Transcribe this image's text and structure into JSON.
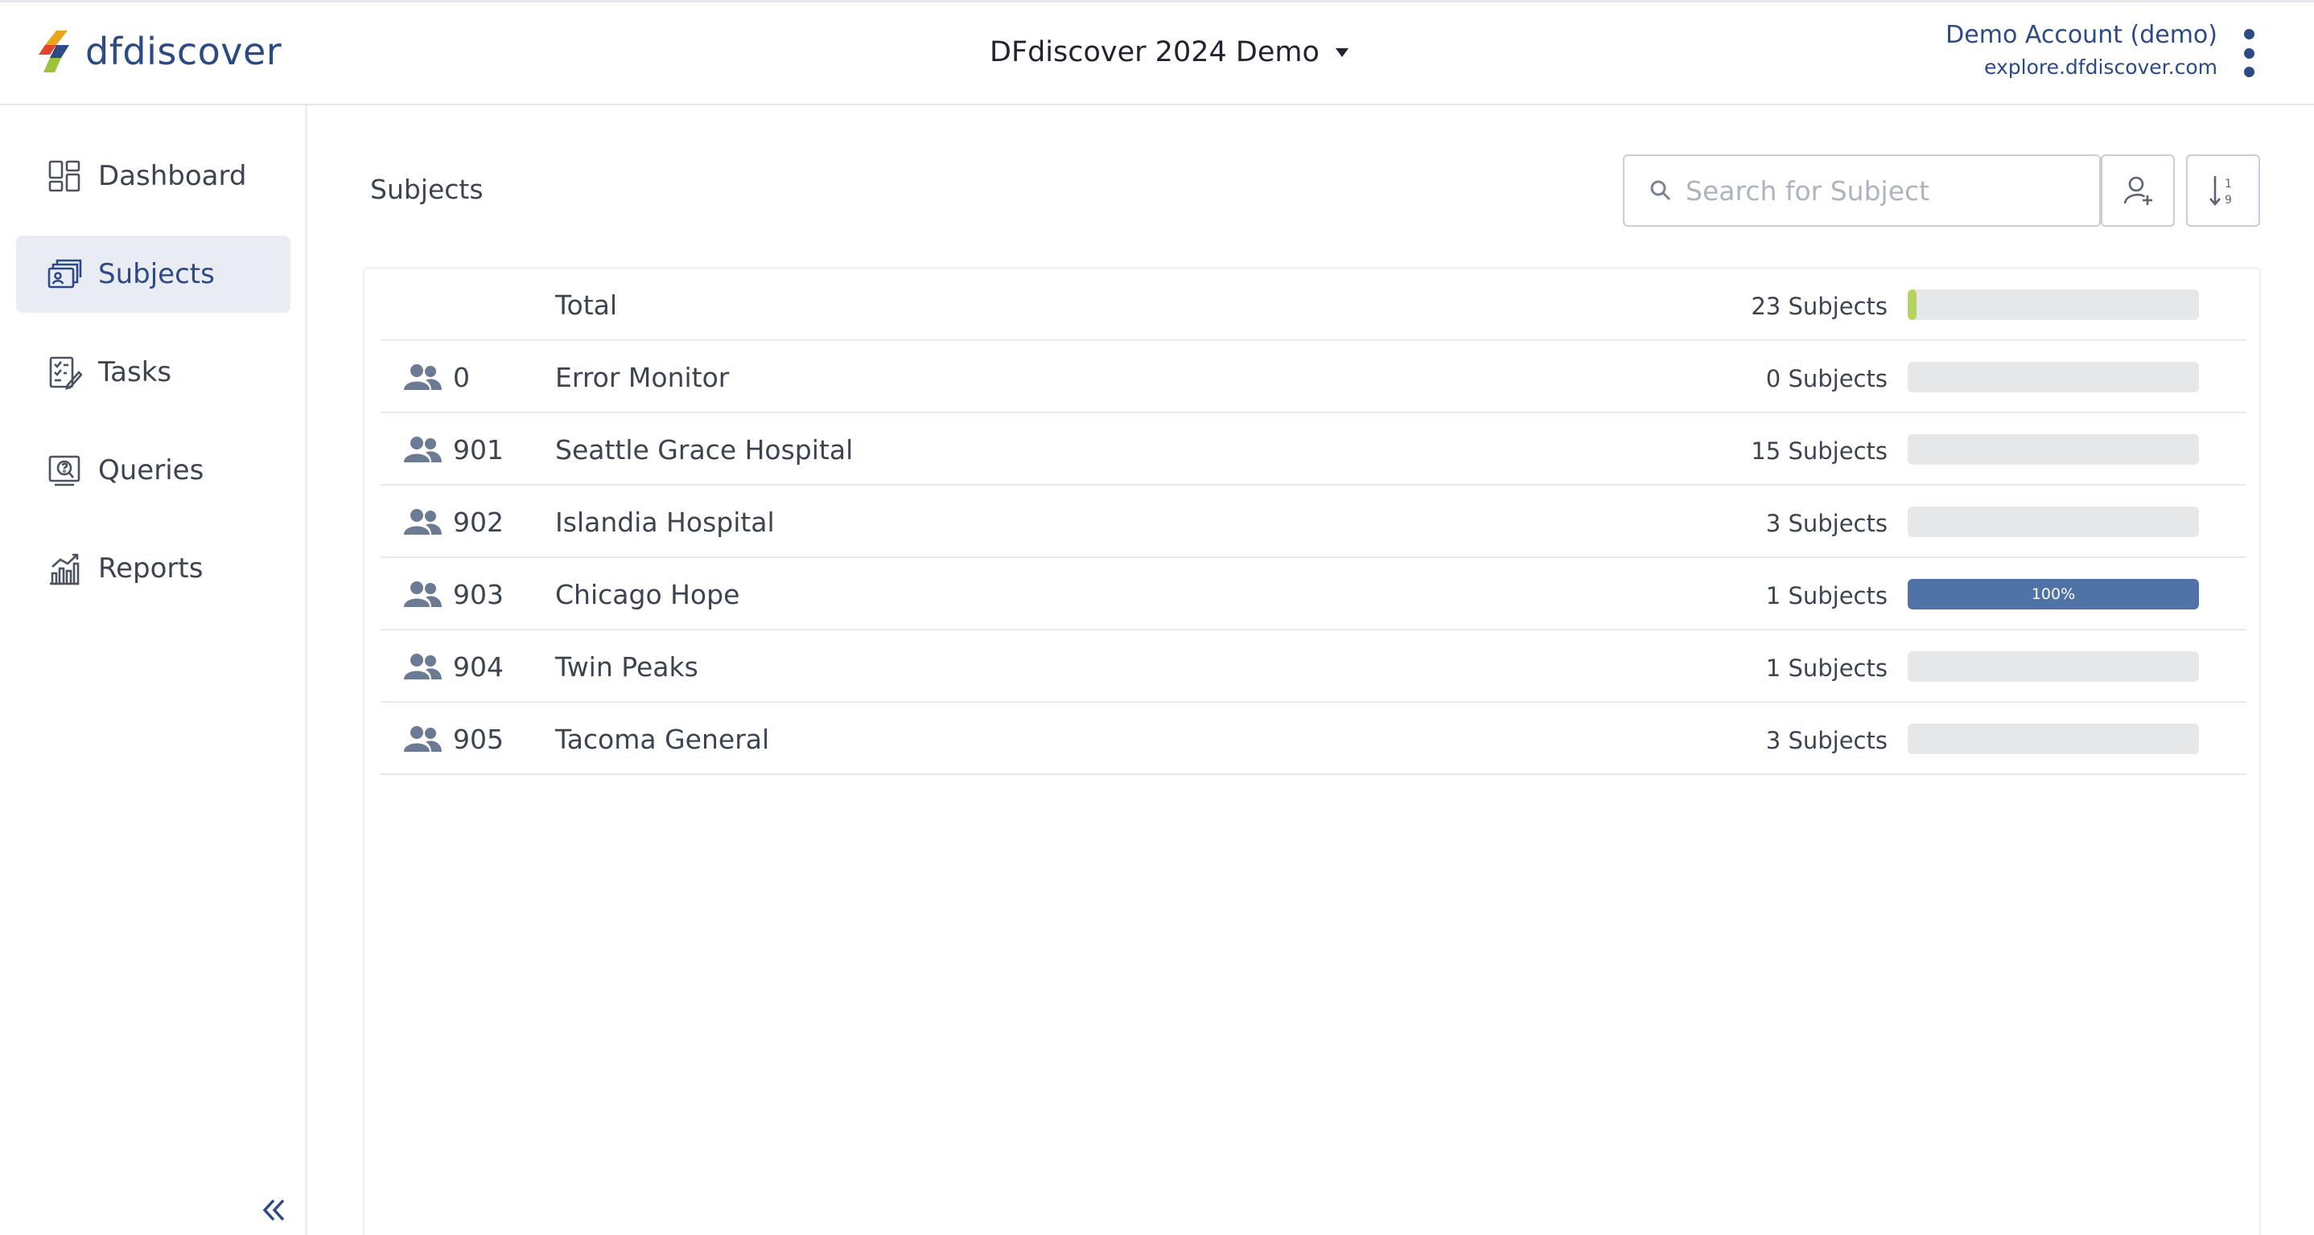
{
  "header": {
    "logo_text": "dfdiscover",
    "study_title": "DFdiscover 2024 Demo",
    "account_name": "Demo Account (demo)",
    "account_host": "explore.dfdiscover.com"
  },
  "sidebar": {
    "items": [
      {
        "label": "Dashboard",
        "icon": "dashboard-icon",
        "active": false
      },
      {
        "label": "Subjects",
        "icon": "subjects-icon",
        "active": true
      },
      {
        "label": "Tasks",
        "icon": "tasks-icon",
        "active": false
      },
      {
        "label": "Queries",
        "icon": "queries-icon",
        "active": false
      },
      {
        "label": "Reports",
        "icon": "reports-icon",
        "active": false
      }
    ],
    "collapse_icon": "double-chevron-left-icon"
  },
  "main": {
    "title": "Subjects",
    "search": {
      "placeholder": "Search for Subject",
      "value": ""
    },
    "add_subject_icon": "add-user-icon",
    "sort_icon": "sort-numeric-icon",
    "total": {
      "name": "Total",
      "count": "23 Subjects",
      "fraction": 0.03,
      "color": "#b5d45a"
    },
    "sites": [
      {
        "id": "0",
        "name": "Error Monitor",
        "count": "0 Subjects",
        "fraction": 0,
        "label": ""
      },
      {
        "id": "901",
        "name": "Seattle Grace Hospital",
        "count": "15 Subjects",
        "fraction": 0,
        "label": ""
      },
      {
        "id": "902",
        "name": "Islandia Hospital",
        "count": "3 Subjects",
        "fraction": 0,
        "label": ""
      },
      {
        "id": "903",
        "name": "Chicago Hope",
        "count": "1 Subjects",
        "fraction": 1,
        "label": "100%"
      },
      {
        "id": "904",
        "name": "Twin Peaks",
        "count": "1 Subjects",
        "fraction": 0,
        "label": ""
      },
      {
        "id": "905",
        "name": "Tacoma General",
        "count": "3 Subjects",
        "fraction": 0,
        "label": ""
      }
    ],
    "colors": {
      "accent": "#2c4a86",
      "progress": "#4f73a6",
      "total_progress": "#b5d45a",
      "track": "#e6e7e9"
    }
  }
}
